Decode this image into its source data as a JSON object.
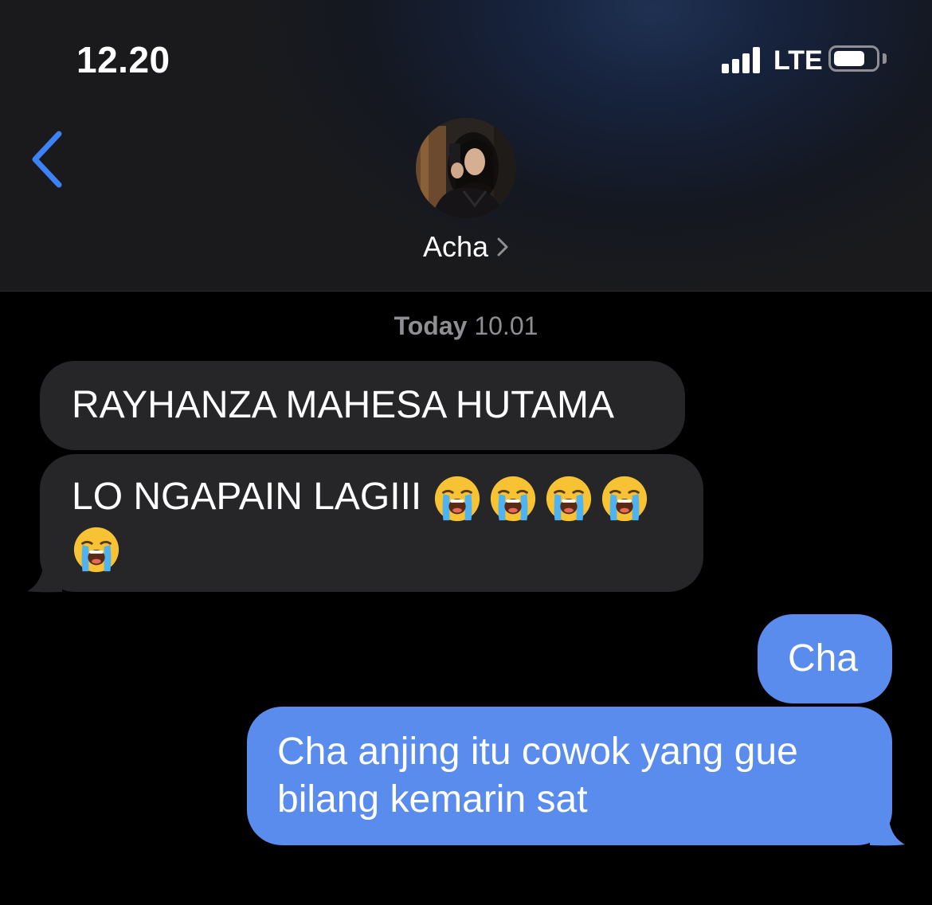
{
  "status_bar": {
    "time": "12.20",
    "network": "LTE",
    "signal_bars": 4,
    "battery_level": 0.75
  },
  "header": {
    "back_icon": "chevron-left-icon",
    "contact_name": "Acha",
    "accent_color": "#3b82f6"
  },
  "thread": {
    "timestamp_day": "Today",
    "timestamp_time": "10.01",
    "messages": [
      {
        "direction": "received",
        "text": "RAYHANZA MAHESA HUTAMA",
        "emoji_count": 0
      },
      {
        "direction": "received",
        "text": "LO NGAPAIN LAGIII",
        "emoji_count": 5,
        "emoji": "loudly-crying-face"
      },
      {
        "direction": "sent",
        "text": "Cha"
      },
      {
        "direction": "sent",
        "line1": "Cha anjing itu cowok yang gue",
        "line2": "bilang kemarin sat"
      }
    ]
  },
  "colors": {
    "received_bubble": "#262629",
    "sent_bubble": "#5a8ced",
    "timestamp": "#8e8e93"
  }
}
